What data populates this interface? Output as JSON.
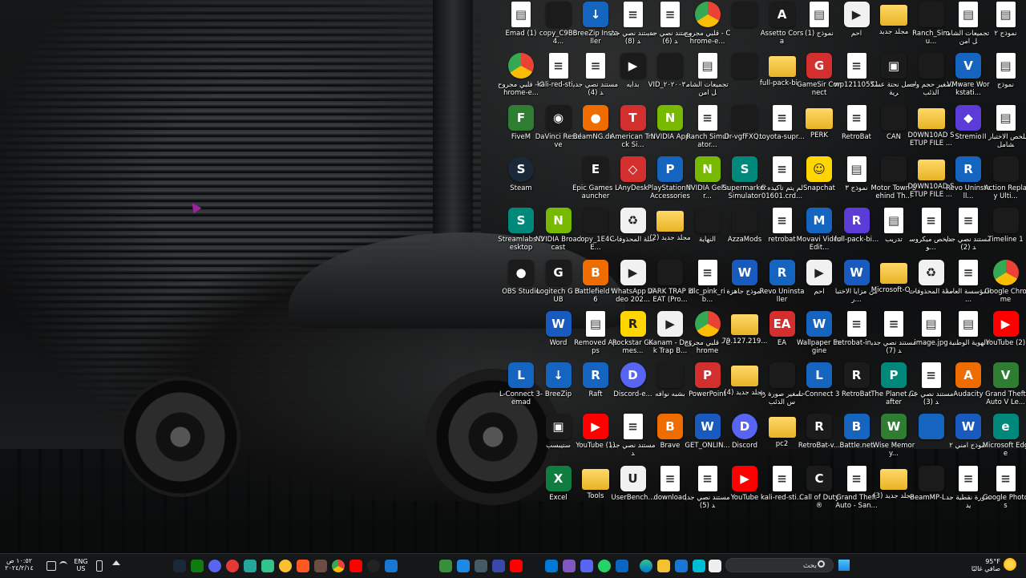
{
  "desktop": {
    "icons": [
      {
        "label": "Emad (1)",
        "icon": "pdf-doc",
        "col": 0,
        "row": 0
      },
      {
        "label": "copy_C9B64...",
        "icon": "dark-file",
        "col": 1,
        "row": 0
      },
      {
        "label": "BreeZip Installer",
        "icon": "breezip",
        "col": 2,
        "row": 0
      },
      {
        "label": "مستند نصي جديد (8)",
        "icon": "text-doc",
        "col": 3,
        "row": 0
      },
      {
        "label": "مستند نصي جديد (6)",
        "icon": "text-doc",
        "col": 4,
        "row": 0
      },
      {
        "label": "قلبي مجروح - Chrome-e...",
        "icon": "chrome",
        "col": 5,
        "row": 0
      },
      {
        "label": "",
        "icon": "dark-file",
        "col": 6,
        "row": 0
      },
      {
        "label": "Assetto Corsa",
        "icon": "assetto",
        "col": 7,
        "row": 0
      },
      {
        "label": "نموذج (1)",
        "icon": "pdf-doc",
        "col": 8,
        "row": 0
      },
      {
        "label": "احم",
        "icon": "media",
        "col": 9,
        "row": 0
      },
      {
        "label": "مجلد جديد",
        "icon": "folder",
        "col": 10,
        "row": 0
      },
      {
        "label": "Ranch_Simu...",
        "icon": "dark-file",
        "col": 11,
        "row": 0
      },
      {
        "label": "تجميعات الشامل امن",
        "icon": "pdf-doc",
        "col": 12,
        "row": 0
      },
      {
        "label": "نموذج ٢",
        "icon": "pdf-doc",
        "col": 13,
        "row": 0
      },
      {
        "label": "قلبي مجروح - Chrome-e...",
        "icon": "chrome",
        "col": 0,
        "row": 1
      },
      {
        "label": "kali-red-sti...",
        "icon": "text-doc",
        "col": 1,
        "row": 1
      },
      {
        "label": "مستند نصي جديد (4)",
        "icon": "text-doc",
        "col": 2,
        "row": 1
      },
      {
        "label": "بدايه",
        "icon": "video",
        "col": 3,
        "row": 1
      },
      {
        "label": "VID_٢٠٢٠٠٣...",
        "icon": "dark-file",
        "col": 4,
        "row": 1
      },
      {
        "label": "تجميعات الشامل امن",
        "icon": "pdf-doc",
        "col": 5,
        "row": 1
      },
      {
        "label": "",
        "icon": "dark-file",
        "col": 6,
        "row": 1
      },
      {
        "label": "full-pack-bi...",
        "icon": "folder",
        "col": 7,
        "row": 1
      },
      {
        "label": "GameSir Connect",
        "icon": "gamesir",
        "col": 8,
        "row": 1
      },
      {
        "label": "wp12110551",
        "icon": "text-doc",
        "col": 9,
        "row": 1
      },
      {
        "label": "اجمل نحتة عسكرية",
        "icon": "image",
        "col": 10,
        "row": 1
      },
      {
        "label": "تصغير حجم وجه الذئب",
        "icon": "dark-file",
        "col": 11,
        "row": 1
      },
      {
        "label": "VMware Workstati...",
        "icon": "vmware",
        "col": 12,
        "row": 1
      },
      {
        "label": "نموذج",
        "icon": "pdf-doc",
        "col": 13,
        "row": 1
      },
      {
        "label": "FiveM",
        "icon": "fivem",
        "col": 0,
        "row": 2
      },
      {
        "label": "DaVinci Resolve",
        "icon": "davinci",
        "col": 1,
        "row": 2
      },
      {
        "label": "BeamNG.dr...",
        "icon": "beamng",
        "col": 2,
        "row": 2
      },
      {
        "label": "American Truck Si...",
        "icon": "truck",
        "col": 3,
        "row": 2
      },
      {
        "label": "NVIDIA App",
        "icon": "nvidia",
        "col": 4,
        "row": 2
      },
      {
        "label": "Ranch Simulator...",
        "icon": "text-doc",
        "col": 5,
        "row": 2
      },
      {
        "label": "Dr-vgfFXQ...",
        "icon": "dark-file",
        "col": 6,
        "row": 2
      },
      {
        "label": "toyota-supr...",
        "icon": "text-doc",
        "col": 7,
        "row": 2
      },
      {
        "label": "PERK",
        "icon": "folder",
        "col": 8,
        "row": 2
      },
      {
        "label": "RetroBat",
        "icon": "text-doc",
        "col": 9,
        "row": 2
      },
      {
        "label": "CAN",
        "icon": "dark-file",
        "col": 10,
        "row": 2
      },
      {
        "label": "D0WN10AD SETUP FILE ...",
        "icon": "folder",
        "col": 11,
        "row": 2
      },
      {
        "label": "Stremio",
        "icon": "stremio",
        "col": 12,
        "row": 2
      },
      {
        "label": "ملخص الاختبار الشامل",
        "icon": "pdf-doc",
        "col": 13,
        "row": 2
      },
      {
        "label": "Steam",
        "icon": "steam",
        "col": 0,
        "row": 3
      },
      {
        "label": "",
        "icon": "none",
        "col": 1,
        "row": 3
      },
      {
        "label": "Epic Games Launcher",
        "icon": "epic",
        "col": 2,
        "row": 3
      },
      {
        "label": "AnyDesk",
        "icon": "anydesk",
        "col": 3,
        "row": 3
      },
      {
        "label": "PlayStation® Accessories",
        "icon": "playstation",
        "col": 4,
        "row": 3
      },
      {
        "label": "NVIDIA GeFor...",
        "icon": "nvidia",
        "col": 5,
        "row": 3
      },
      {
        "label": "Supermarket Simulator",
        "icon": "supermarket",
        "col": 6,
        "row": 3
      },
      {
        "label": "لم يتم تأكيده 601601.crd...",
        "icon": "text-doc",
        "col": 7,
        "row": 3
      },
      {
        "label": "Snapchat",
        "icon": "snapchat",
        "col": 8,
        "row": 3
      },
      {
        "label": "نموذج ٣",
        "icon": "pdf-doc",
        "col": 9,
        "row": 3
      },
      {
        "label": "Motor Town Behind Th...",
        "icon": "dark-file",
        "col": 10,
        "row": 3
      },
      {
        "label": "D0WN10AD SETUP FILE ...",
        "icon": "folder",
        "col": 11,
        "row": 3
      },
      {
        "label": "Revo Uninstall...",
        "icon": "revo",
        "col": 12,
        "row": 3
      },
      {
        "label": "Action Replay Ulti...",
        "icon": "dark-file",
        "col": 13,
        "row": 3
      },
      {
        "label": "Streamlabs Desktop",
        "icon": "streamlabs",
        "col": 0,
        "row": 4
      },
      {
        "label": "NVIDIA Broadcast",
        "icon": "nvidia",
        "col": 1,
        "row": 4
      },
      {
        "label": "copy_1E4CE...",
        "icon": "dark-file",
        "col": 2,
        "row": 4
      },
      {
        "label": "سلة المحذوفات",
        "icon": "recycle",
        "col": 3,
        "row": 4
      },
      {
        "label": "مجلد جديد (2)",
        "icon": "folder",
        "col": 4,
        "row": 4
      },
      {
        "label": "النهاية",
        "icon": "dark-file",
        "col": 5,
        "row": 4
      },
      {
        "label": "AzzaMods",
        "icon": "dark-file",
        "col": 6,
        "row": 4
      },
      {
        "label": "retrobat",
        "icon": "text-doc",
        "col": 7,
        "row": 4
      },
      {
        "label": "Movavi Video Edit...",
        "icon": "movavi",
        "col": 8,
        "row": 4
      },
      {
        "label": "full-pack-bi...",
        "icon": "winrar",
        "col": 9,
        "row": 4
      },
      {
        "label": "تدريب",
        "icon": "pdf-doc",
        "col": 10,
        "row": 4
      },
      {
        "label": "ملخص ميكروسو...",
        "icon": "text-doc",
        "col": 11,
        "row": 4
      },
      {
        "label": "مستند نصي جديد (2)",
        "icon": "text-doc",
        "col": 12,
        "row": 4
      },
      {
        "label": "Timeline 1",
        "icon": "dark-file",
        "col": 13,
        "row": 4
      },
      {
        "label": "OBS Studio",
        "icon": "obs",
        "col": 0,
        "row": 5
      },
      {
        "label": "Logitech G HUB",
        "icon": "logitech",
        "col": 1,
        "row": 5
      },
      {
        "label": "Battlefield™ 6",
        "icon": "battlefield",
        "col": 2,
        "row": 5
      },
      {
        "label": "WhatsApp Video 202...",
        "icon": "media",
        "col": 3,
        "row": 5
      },
      {
        "label": "DARK TRAP BEAT (Pro...",
        "icon": "dark-file",
        "col": 4,
        "row": 5
      },
      {
        "label": "dlc_pink_rib...",
        "icon": "text-doc",
        "col": 5,
        "row": 5
      },
      {
        "label": "نموذج جاهزة",
        "icon": "word",
        "col": 6,
        "row": 5
      },
      {
        "label": "Revo Uninstaller",
        "icon": "revo",
        "col": 7,
        "row": 5
      },
      {
        "label": "احم",
        "icon": "media",
        "col": 8,
        "row": 5
      },
      {
        "label": "من مزايا الاختبار...",
        "icon": "word",
        "col": 9,
        "row": 5
      },
      {
        "label": "Microsoft-O...",
        "icon": "folder",
        "col": 10,
        "row": 5
      },
      {
        "label": "سلة المحذوفات",
        "icon": "recycle",
        "col": 11,
        "row": 5
      },
      {
        "label": "المؤسسة العامة ...",
        "icon": "text-doc",
        "col": 12,
        "row": 5
      },
      {
        "label": "Google Chrome",
        "icon": "chrome",
        "col": 13,
        "row": 5
      },
      {
        "label": "Word",
        "icon": "word",
        "col": 1,
        "row": 6
      },
      {
        "label": "Removed Apps",
        "icon": "pdf-doc",
        "col": 2,
        "row": 6
      },
      {
        "label": "Rockstar Games...",
        "icon": "rockstar",
        "col": 3,
        "row": 6
      },
      {
        "label": "Kanam - Dark Trap B...",
        "icon": "media",
        "col": 4,
        "row": 6
      },
      {
        "label": "قلبي مجروح - Chrome",
        "icon": "chrome",
        "col": 5,
        "row": 6
      },
      {
        "label": "79.127.219...",
        "icon": "folder",
        "col": 6,
        "row": 6
      },
      {
        "label": "EA",
        "icon": "ea",
        "col": 7,
        "row": 6
      },
      {
        "label": "Wallpaper Engine",
        "icon": "wallpaper",
        "col": 8,
        "row": 6
      },
      {
        "label": "retrobat-in...",
        "icon": "text-doc",
        "col": 9,
        "row": 6
      },
      {
        "label": "مستند نصي جديد (7)",
        "icon": "text-doc",
        "col": 10,
        "row": 6
      },
      {
        "label": "image.jpg",
        "icon": "pdf-doc",
        "col": 11,
        "row": 6
      },
      {
        "label": "الهوية الوطنية",
        "icon": "pdf-doc",
        "col": 12,
        "row": 6
      },
      {
        "label": "YouTube (2)",
        "icon": "youtube",
        "col": 13,
        "row": 6
      },
      {
        "label": "L-Connect 3-emad",
        "icon": "lconnect",
        "col": 0,
        "row": 7
      },
      {
        "label": "BreeZip",
        "icon": "breezip",
        "col": 1,
        "row": 7
      },
      {
        "label": "Raft",
        "icon": "raft",
        "col": 2,
        "row": 7
      },
      {
        "label": "Discord-e...",
        "icon": "discord",
        "col": 3,
        "row": 7
      },
      {
        "label": "بشبه نوافه",
        "icon": "dark-file",
        "col": 4,
        "row": 7
      },
      {
        "label": "PowerPoint",
        "icon": "powerpoint",
        "col": 5,
        "row": 7
      },
      {
        "label": "مجلد جديد (4)",
        "icon": "folder",
        "col": 6,
        "row": 7
      },
      {
        "label": "تصغير صورة رأس الذئب",
        "icon": "dark-file",
        "col": 7,
        "row": 7
      },
      {
        "label": "L-Connect 3",
        "icon": "lconnect",
        "col": 8,
        "row": 7
      },
      {
        "label": "RetroBat",
        "icon": "retrobat",
        "col": 9,
        "row": 7
      },
      {
        "label": "The Planet Crafter",
        "icon": "planet",
        "col": 10,
        "row": 7
      },
      {
        "label": "مستند نصي جديد (3)",
        "icon": "text-doc",
        "col": 11,
        "row": 7
      },
      {
        "label": "Audacity",
        "icon": "audacity",
        "col": 12,
        "row": 7
      },
      {
        "label": "Grand Theft Auto V Le...",
        "icon": "gta",
        "col": 13,
        "row": 7
      },
      {
        "label": "ستيبسب",
        "icon": "image",
        "col": 1,
        "row": 8
      },
      {
        "label": "YouTube (1)",
        "icon": "youtube",
        "col": 2,
        "row": 8
      },
      {
        "label": "مستند نصي جديد",
        "icon": "text-doc",
        "col": 3,
        "row": 8
      },
      {
        "label": "Brave",
        "icon": "brave",
        "col": 4,
        "row": 8
      },
      {
        "label": "GET_ONLIN...",
        "icon": "word",
        "col": 5,
        "row": 8
      },
      {
        "label": "Discord",
        "icon": "discord",
        "col": 6,
        "row": 8
      },
      {
        "label": "pc2",
        "icon": "folder",
        "col": 7,
        "row": 8
      },
      {
        "label": "RetroBat-v...",
        "icon": "retrobat",
        "col": 8,
        "row": 8
      },
      {
        "label": "Battle.net",
        "icon": "battlenet",
        "col": 9,
        "row": 8
      },
      {
        "label": "Wise Memory...",
        "icon": "wise",
        "col": 10,
        "row": 8
      },
      {
        "label": "",
        "icon": "folder-blue",
        "col": 11,
        "row": 8
      },
      {
        "label": "نموذج امني ٢",
        "icon": "word",
        "col": 12,
        "row": 8
      },
      {
        "label": "Microsoft Edge",
        "icon": "edge",
        "col": 13,
        "row": 8
      },
      {
        "label": "Excel",
        "icon": "excel",
        "col": 1,
        "row": 9
      },
      {
        "label": "Tools",
        "icon": "folder",
        "col": 2,
        "row": 9
      },
      {
        "label": "UserBench...",
        "icon": "userbench",
        "col": 3,
        "row": 9
      },
      {
        "label": "download",
        "icon": "text-doc",
        "col": 4,
        "row": 9
      },
      {
        "label": "مستند نصي جديد (5)",
        "icon": "text-doc",
        "col": 5,
        "row": 9
      },
      {
        "label": "YouTube",
        "icon": "youtube",
        "col": 6,
        "row": 9
      },
      {
        "label": "kali-red-sti...",
        "icon": "text-doc",
        "col": 7,
        "row": 9
      },
      {
        "label": "Call of Duty®",
        "icon": "cod",
        "col": 8,
        "row": 9
      },
      {
        "label": "Grand Theft Auto - San...",
        "icon": "text-doc",
        "col": 9,
        "row": 9
      },
      {
        "label": "مجلد جديد (3)",
        "icon": "folder",
        "col": 10,
        "row": 9
      },
      {
        "label": "BeamMP-L...",
        "icon": "dark-file",
        "col": 11,
        "row": 9
      },
      {
        "label": "صورة نقطية جديد",
        "icon": "text-doc",
        "col": 12,
        "row": 9
      },
      {
        "label": "Google Photos",
        "icon": "text-doc",
        "col": 13,
        "row": 9
      }
    ]
  },
  "taskbar": {
    "clock_time": "١٠:٥٢ ص",
    "clock_date": "٢٠٢٤/٢/١٤",
    "language": "ENG",
    "region": "US",
    "search_placeholder": "بحث",
    "weather_temp": "95°F",
    "weather_desc": "صافي غالبًا"
  },
  "colors": {
    "taskbar_bg": "#141618",
    "folder": "#f2c230",
    "accent": "#1e88e5"
  }
}
